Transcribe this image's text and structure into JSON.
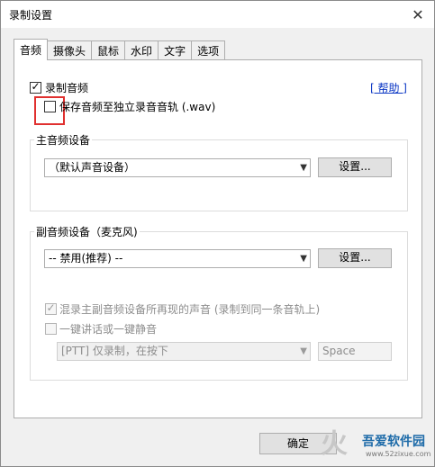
{
  "window": {
    "title": "录制设置"
  },
  "tabs": [
    {
      "label": "音频",
      "active": true
    },
    {
      "label": "摄像头",
      "active": false
    },
    {
      "label": "鼠标",
      "active": false
    },
    {
      "label": "水印",
      "active": false
    },
    {
      "label": "文字",
      "active": false
    },
    {
      "label": "选项",
      "active": false
    }
  ],
  "audio": {
    "record_audio": {
      "label": "录制音频",
      "checked": true
    },
    "help_link": "[ 帮助 ]",
    "save_separate": {
      "label": "保存音频至独立录音音轨 (.wav)",
      "checked": false
    },
    "main_device": {
      "group_title": "主音频设备",
      "selected": "（默认声音设备）",
      "settings_button": "设置..."
    },
    "secondary_device": {
      "group_title": "副音频设备（麦克风)",
      "selected": "-- 禁用(推荐) --",
      "settings_button": "设置...",
      "mix_option": {
        "label": "混录主副音频设备所再现的声音 (录制到同一条音轨上)",
        "checked": true,
        "disabled": true
      },
      "ptt_option": {
        "label": "一键讲话或一键静音",
        "checked": false,
        "disabled": true
      },
      "ptt_mode": "[PTT] 仅录制，在按下",
      "ptt_key": "Space"
    }
  },
  "footer": {
    "ok_button": "确定"
  },
  "watermark": {
    "logo": "火下载",
    "name": "吾爱软件园",
    "url": "www.52zixue.com"
  },
  "colors": {
    "link": "#0a36c4",
    "highlight_box": "#e0302f",
    "panel_bg": "#ffffff",
    "window_bg": "#f0f0f0"
  }
}
